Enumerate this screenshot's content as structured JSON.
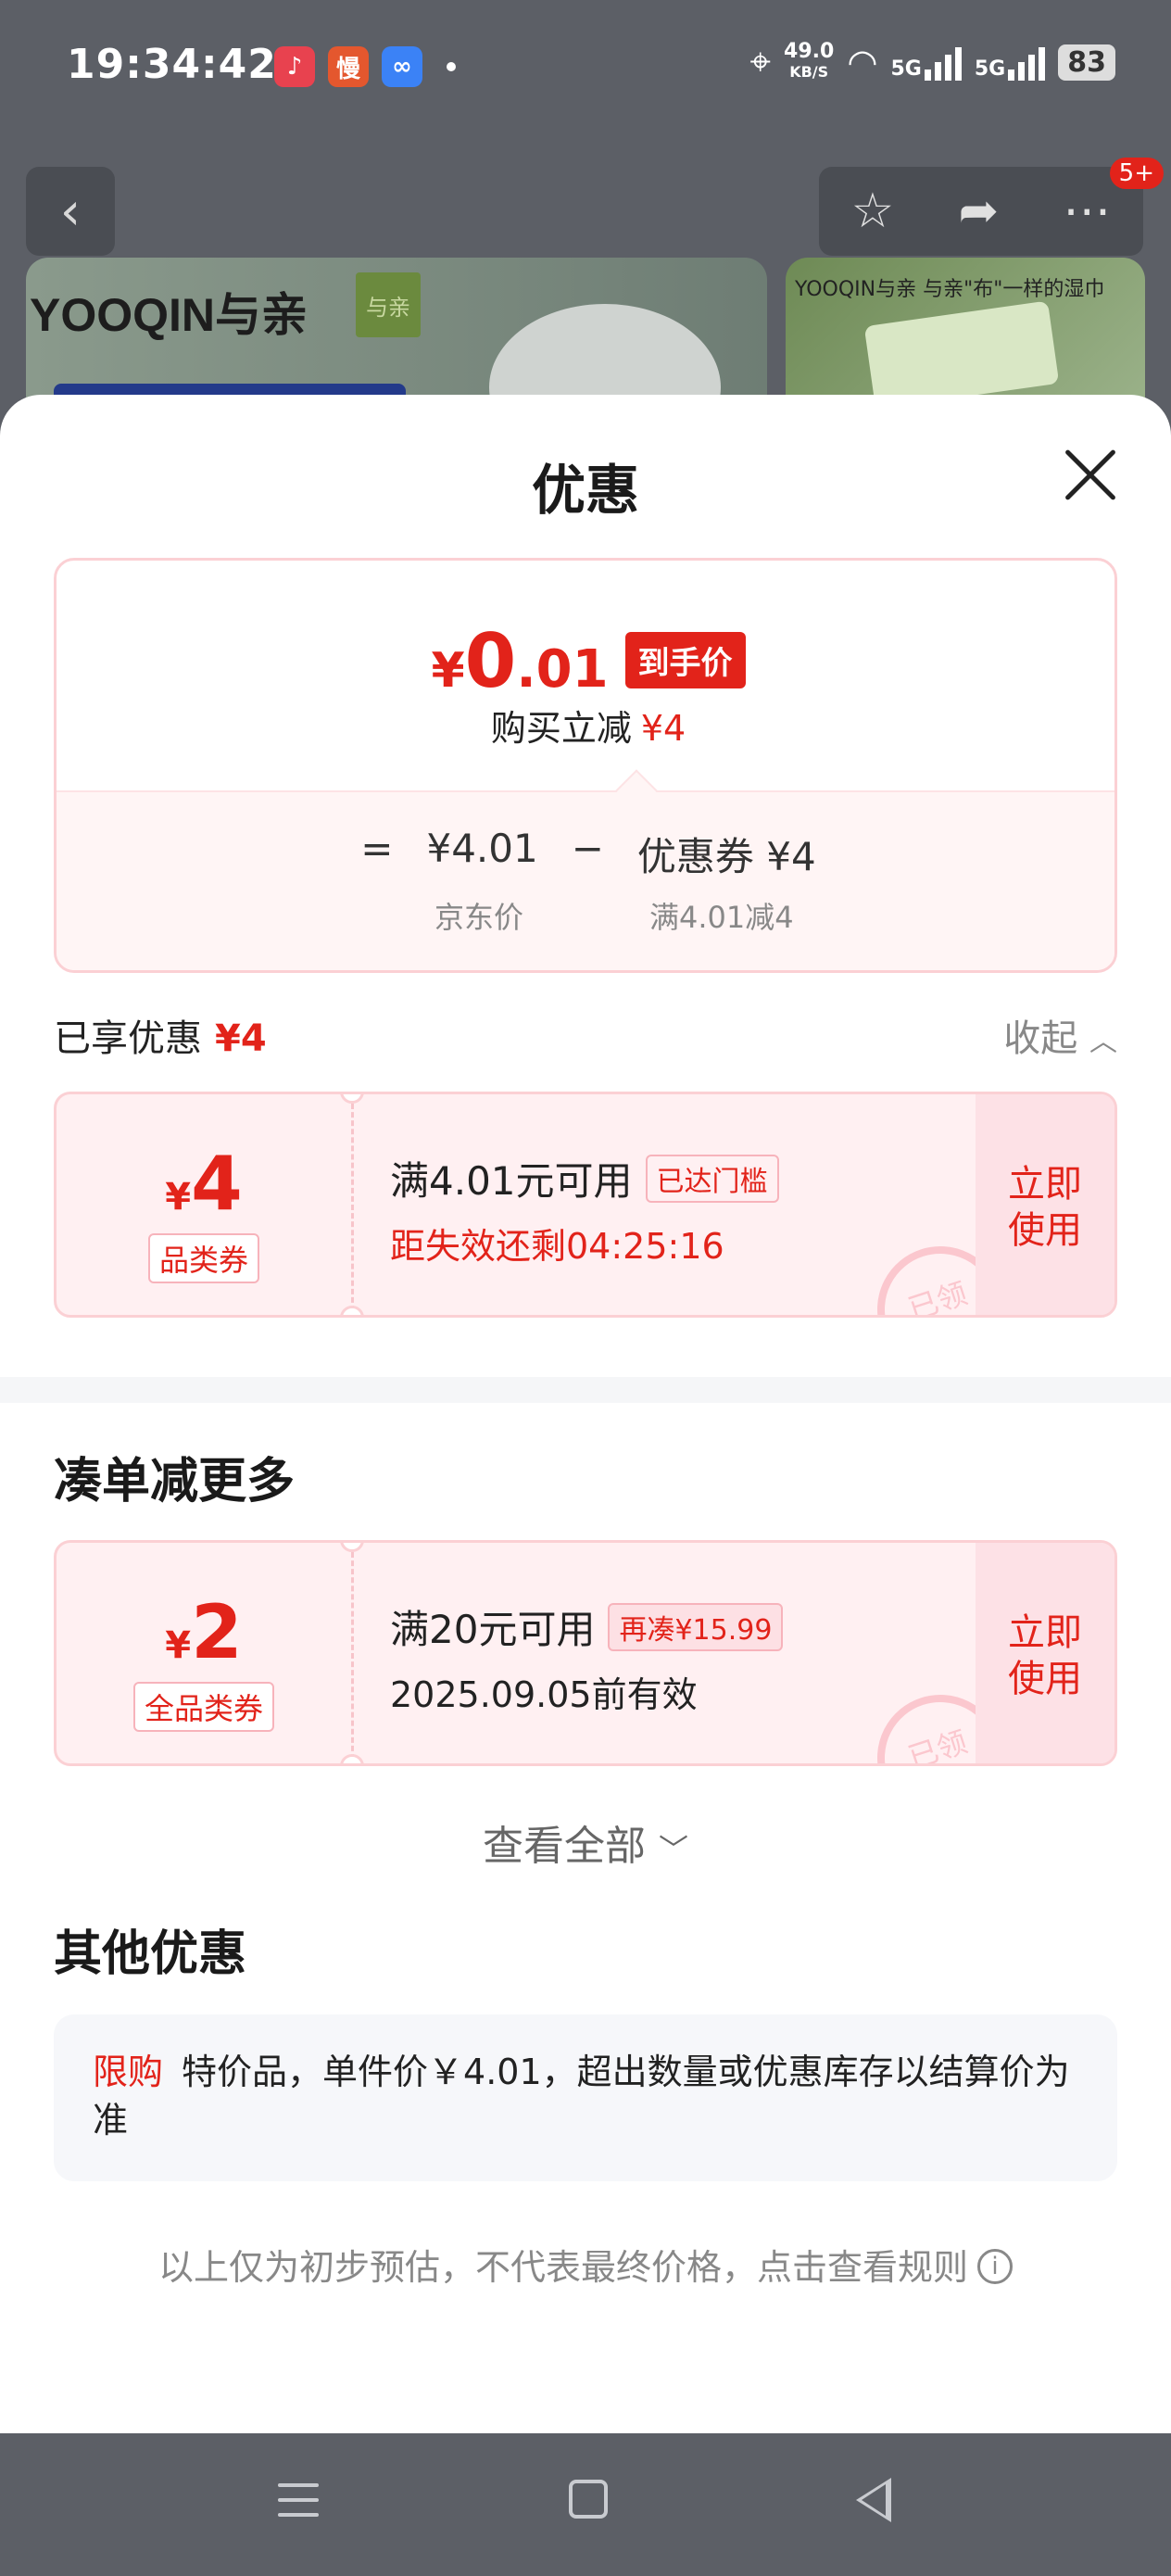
{
  "status_bar": {
    "time": "19:34:42",
    "app_icons": [
      {
        "glyph": "♪",
        "color": "#e8424f",
        "name": "music-app-icon"
      },
      {
        "glyph": "慢",
        "color": "#e4572e",
        "name": "app-icon-man"
      },
      {
        "glyph": "∞",
        "color": "#3b82f6",
        "name": "app-icon-link"
      }
    ],
    "speed_value": "49.0",
    "speed_unit": "KB/S",
    "sig1": "5G",
    "sig2": "5G",
    "battery": "83"
  },
  "background": {
    "badge": "5+",
    "brand": "YOOQIN与亲",
    "brand_tag": "与亲",
    "side_text": "YOOQIN与亲 与亲\"布\"一样的湿巾"
  },
  "sheet": {
    "title": "优惠",
    "summary": {
      "currency": "¥",
      "final_int": "0",
      "final_dec": ".01",
      "final_tag": "到手价",
      "sub_label": "购买立减",
      "sub_value": "¥4",
      "eq": "=",
      "jd_price": "¥4.01",
      "minus": "−",
      "coupon_part": "优惠券 ¥4",
      "jd_price_label": "京东价",
      "coupon_rule_label": "满4.01减4"
    },
    "enjoyed": {
      "label": "已享优惠",
      "amount": "¥4",
      "collapse": "收起"
    },
    "coupon1": {
      "currency": "¥",
      "value": "4",
      "type": "品类券",
      "condition": "满4.01元可用",
      "chip": "已达门槛",
      "countdown": "距失效还剩04:25:16",
      "action": "立即使用",
      "stamp": "已领"
    },
    "more_section": {
      "title": "凑单减更多"
    },
    "coupon2": {
      "currency": "¥",
      "value": "2",
      "type": "全品类券",
      "condition": "满20元可用",
      "chip": "再凑¥15.99",
      "validity": "2025.09.05前有效",
      "action": "立即使用",
      "stamp": "已领"
    },
    "view_all": "查看全部",
    "other_section": {
      "title": "其他优惠",
      "tag": "限购",
      "text": "特价品，单件价￥4.01，超出数量或优惠库存以结算价为准"
    },
    "disclaimer": "以上仅为初步预估，不代表最终价格，点击查看规则"
  },
  "colors": {
    "accent_red": "#e2231a",
    "coupon_bg": "#fff0f2",
    "coupon_border": "#fbd0d4"
  }
}
